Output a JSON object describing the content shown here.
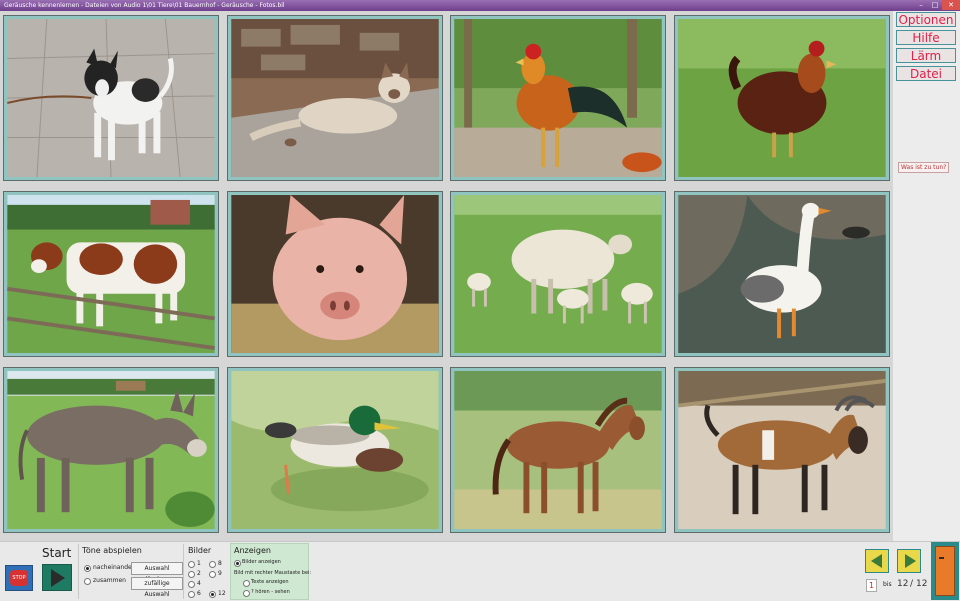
{
  "window": {
    "title": "Geräusche kennenlernen - Dateien von Audio 1\\01 Tiere\\01 Bauernhof - Geräusche - Fotos.bil"
  },
  "tiles": [
    {
      "name": "dog"
    },
    {
      "name": "cat"
    },
    {
      "name": "rooster"
    },
    {
      "name": "hen"
    },
    {
      "name": "cow"
    },
    {
      "name": "pig"
    },
    {
      "name": "sheep"
    },
    {
      "name": "goose"
    },
    {
      "name": "donkey"
    },
    {
      "name": "duck"
    },
    {
      "name": "horse"
    },
    {
      "name": "goat"
    }
  ],
  "sidebar": {
    "items": [
      "Optionen",
      "Hilfe",
      "Lärm",
      "Datei"
    ],
    "help_link": "Was ist zu tun?"
  },
  "bottom": {
    "start_label": "Start",
    "stop_label": "STOP",
    "toene": {
      "title": "Töne abspielen",
      "options": [
        "nacheinander",
        "zusammen"
      ],
      "btn_clear": "Auswahl löschen",
      "btn_random": "zufällige Auswahl"
    },
    "bilder": {
      "title": "Bilder",
      "col1": [
        "1",
        "2",
        "4",
        "6"
      ],
      "col2": [
        "8",
        "9",
        "",
        "12"
      ]
    },
    "anzeigen": {
      "title": "Anzeigen",
      "opt1": "Bilder anzeigen",
      "subtitle": "Bild mit rechter Maustaste bei:",
      "opt2": "Texte anzeigen",
      "opt3": "? hören - sehen"
    },
    "pager": {
      "from": "1",
      "bis": "bis",
      "to": "12",
      "sep": "/",
      "total": "12"
    }
  },
  "colors": {
    "accent": "#e0214a",
    "tile_border": "#8fc4c0",
    "panel_green": "#cfe8d2"
  }
}
